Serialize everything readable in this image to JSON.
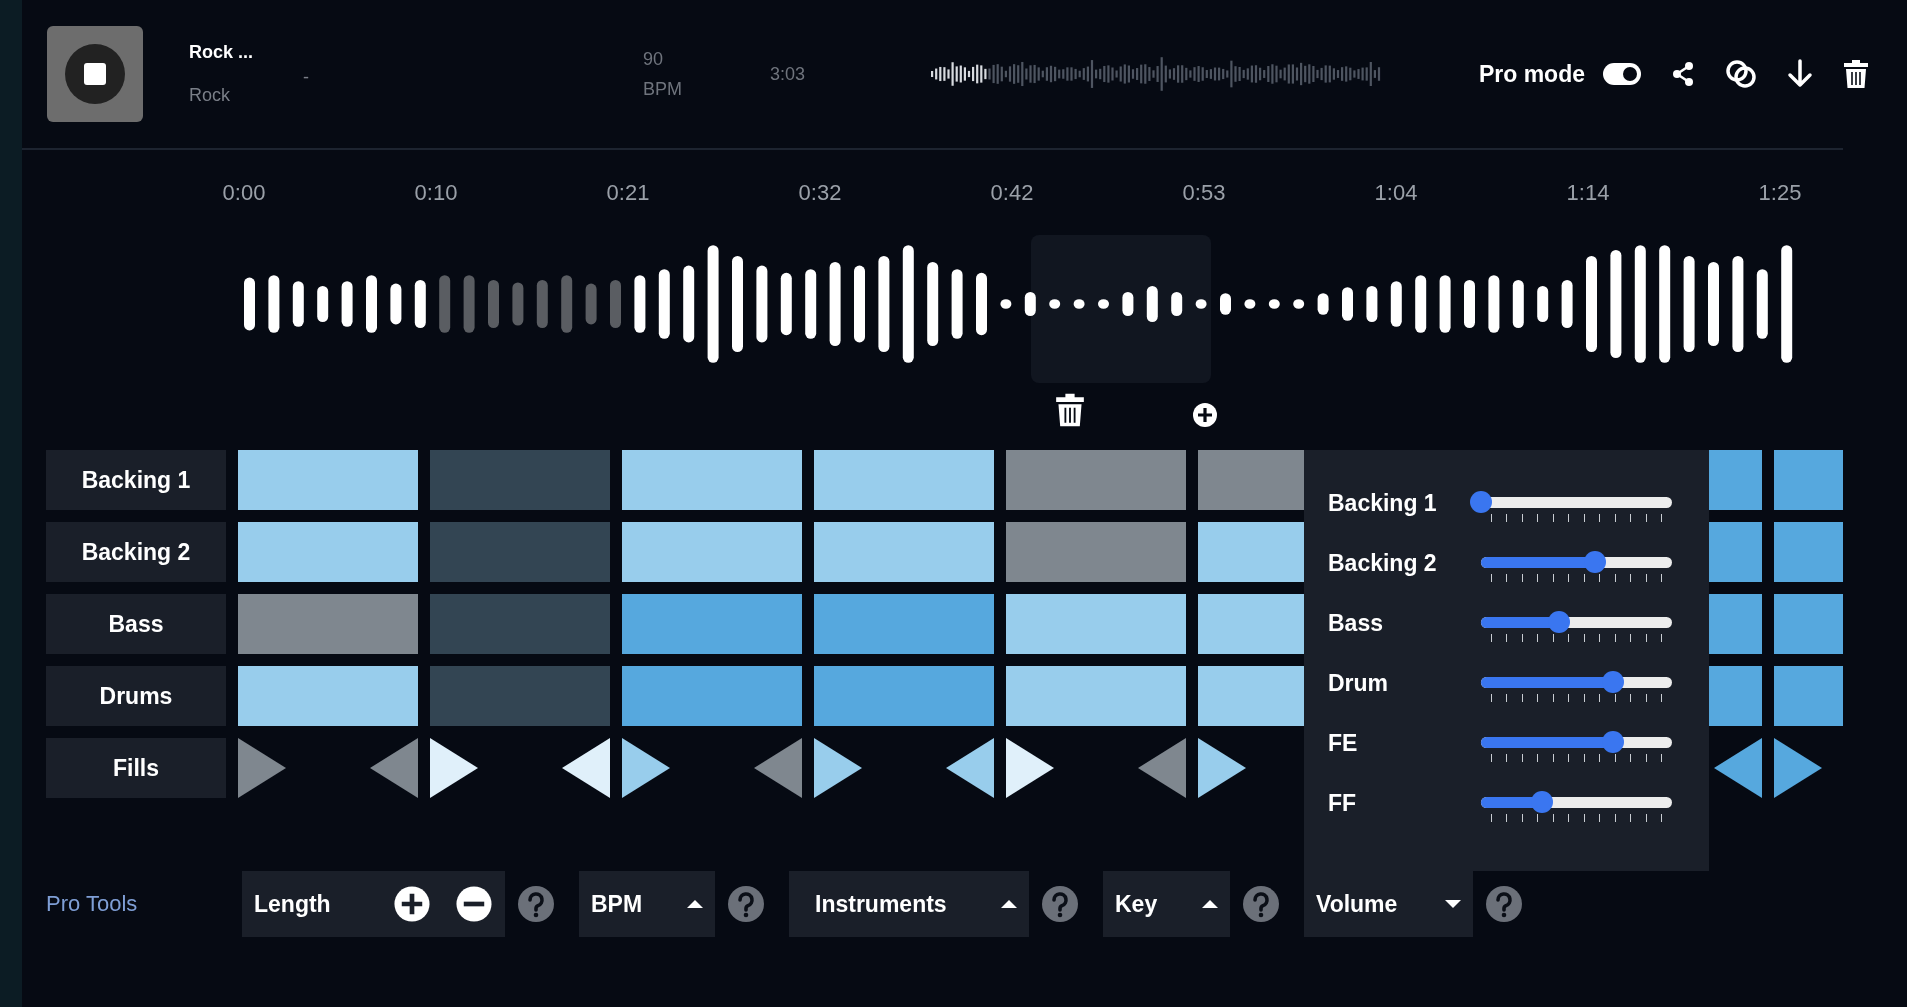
{
  "header": {
    "track_title": "Rock ...",
    "genre": "Rock",
    "artist": "-",
    "tempo": "90 BPM",
    "duration": "3:03",
    "pro_mode": {
      "label": "Pro mode",
      "on": true
    }
  },
  "timeline": {
    "ticks": [
      "0:00",
      "0:10",
      "0:21",
      "0:32",
      "0:42",
      "0:53",
      "1:04",
      "1:14",
      "1:25"
    ]
  },
  "tracks": [
    {
      "name": "Backing 1",
      "cells": [
        {
          "color": "#98cdec"
        },
        {
          "color": "#334553"
        },
        {
          "color": "#98cdec"
        },
        {
          "color": "#98cdec"
        },
        {
          "color": "#7f878f"
        },
        {
          "color": "#7f878f"
        },
        null,
        {
          "color": "#56a8de"
        },
        {
          "color": "#56a8de"
        }
      ]
    },
    {
      "name": "Backing 2",
      "cells": [
        {
          "color": "#98cdec"
        },
        {
          "color": "#334553"
        },
        {
          "color": "#98cdec"
        },
        {
          "color": "#98cdec"
        },
        {
          "color": "#7f878f"
        },
        {
          "color": "#98cdec"
        },
        null,
        {
          "color": "#56a8de"
        },
        {
          "color": "#56a8de"
        }
      ]
    },
    {
      "name": "Bass",
      "cells": [
        {
          "color": "#7f878f"
        },
        {
          "color": "#334553"
        },
        {
          "color": "#56a8de"
        },
        {
          "color": "#56a8de"
        },
        {
          "color": "#98cdec"
        },
        {
          "color": "#98cdec"
        },
        null,
        {
          "color": "#56a8de"
        },
        {
          "color": "#56a8de"
        }
      ]
    },
    {
      "name": "Drums",
      "cells": [
        {
          "color": "#98cdec"
        },
        {
          "color": "#334553"
        },
        {
          "color": "#56a8de"
        },
        {
          "color": "#56a8de"
        },
        {
          "color": "#98cdec"
        },
        {
          "color": "#98cdec"
        },
        null,
        {
          "color": "#56a8de"
        },
        {
          "color": "#56a8de"
        }
      ]
    }
  ],
  "fills": {
    "label": "Fills",
    "columns": [
      {
        "start": {
          "color": "#7f878f"
        },
        "end": {
          "color": "#7f878f"
        }
      },
      {
        "start": {
          "color": "#e0f0fa"
        },
        "end": {
          "color": "#e0f0fa"
        }
      },
      {
        "start": {
          "color": "#98cdec"
        },
        "end": {
          "color": "#7f878f"
        }
      },
      {
        "start": {
          "color": "#98cdec"
        },
        "end": {
          "color": "#98cdec"
        }
      },
      {
        "start": {
          "color": "#e0f0fa"
        },
        "end": {
          "color": "#7f878f"
        }
      },
      {
        "start": {
          "color": "#98cdec"
        }
      },
      {},
      {
        "end": {
          "color": "#56a8de"
        }
      },
      {
        "start": {
          "color": "#56a8de"
        }
      }
    ]
  },
  "volume_popup": {
    "channels": [
      {
        "name": "Backing 1",
        "level": 0
      },
      {
        "name": "Backing 2",
        "level": 0.6
      },
      {
        "name": "Bass",
        "level": 0.41
      },
      {
        "name": "Drum",
        "level": 0.69
      },
      {
        "name": "FE",
        "level": 0.69
      },
      {
        "name": "FF",
        "level": 0.32
      }
    ]
  },
  "pro_tools": {
    "label": "Pro Tools",
    "controls": [
      {
        "kind": "stepper",
        "label": "Length"
      },
      {
        "kind": "dropdown",
        "label": "BPM",
        "expanded": false
      },
      {
        "kind": "dropdown",
        "label": "Instruments",
        "expanded": false
      },
      {
        "kind": "dropdown",
        "label": "Key",
        "expanded": false
      },
      {
        "kind": "dropdown",
        "label": "Volume",
        "expanded": true
      }
    ]
  }
}
